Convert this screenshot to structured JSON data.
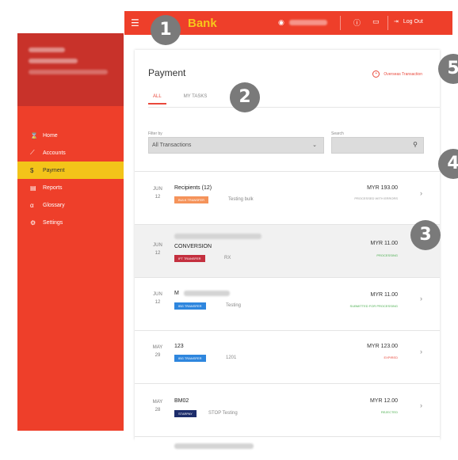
{
  "topbar": {
    "brand": "Bank",
    "menu_icon": "hamburger-icon",
    "logout_label": "Log Out"
  },
  "sidebar": {
    "items": [
      {
        "label": "Home",
        "icon": "hourglass-icon"
      },
      {
        "label": "Accounts",
        "icon": "chart-icon"
      },
      {
        "label": "Payment",
        "icon": "payment-icon",
        "active": true
      },
      {
        "label": "Reports",
        "icon": "report-icon"
      },
      {
        "label": "Glossary",
        "icon": "glossary-icon"
      },
      {
        "label": "Settings",
        "icon": "settings-icon"
      }
    ]
  },
  "page": {
    "title": "Payment",
    "overseas_link": "Overseas Transaction",
    "tabs": [
      "ALL",
      "MY TASKS"
    ],
    "filter_label": "Filter by",
    "filter_value": "All Transactions",
    "search_label": "Search",
    "search_placeholder": ""
  },
  "transactions": [
    {
      "month": "JUN",
      "day": "12",
      "title": "Recipients (12)",
      "badge": "BULK TRANSFER",
      "badge_color": "#f5935a",
      "note": "Testing bulk",
      "amount": "MYR 193.00",
      "status": "PROCESSED WITH ERRORS",
      "status_color": "#999999"
    },
    {
      "month": "JUN",
      "day": "12",
      "title": "CONVERSION",
      "badge": "IFT TRANSFER",
      "badge_color": "#c4303f",
      "note": "RX",
      "amount": "MYR 11.00",
      "status": "PROCESSING",
      "status_color": "#4caf50"
    },
    {
      "month": "JUN",
      "day": "12",
      "title": "M",
      "badge": "IBG TRANSFER",
      "badge_color": "#2e86de",
      "note": "Testing",
      "amount": "MYR 11.00",
      "status": "SUBMITTED FOR PROCESSING",
      "status_color": "#4caf50"
    },
    {
      "month": "MAY",
      "day": "29",
      "title": "123",
      "badge": "IBG TRANSFER",
      "badge_color": "#2e86de",
      "note": "1201",
      "amount": "MYR 123.00",
      "status": "EXPIRED",
      "status_color": "#e9493c"
    },
    {
      "month": "MAY",
      "day": "28",
      "title": "BM02",
      "badge": "STARPAY",
      "badge_color": "#1d2d6b",
      "note": "STOP Testing",
      "amount": "MYR 12.00",
      "status": "REJECTED",
      "status_color": "#4caf50"
    }
  ],
  "callouts": [
    "1",
    "2",
    "3",
    "4",
    "5"
  ]
}
